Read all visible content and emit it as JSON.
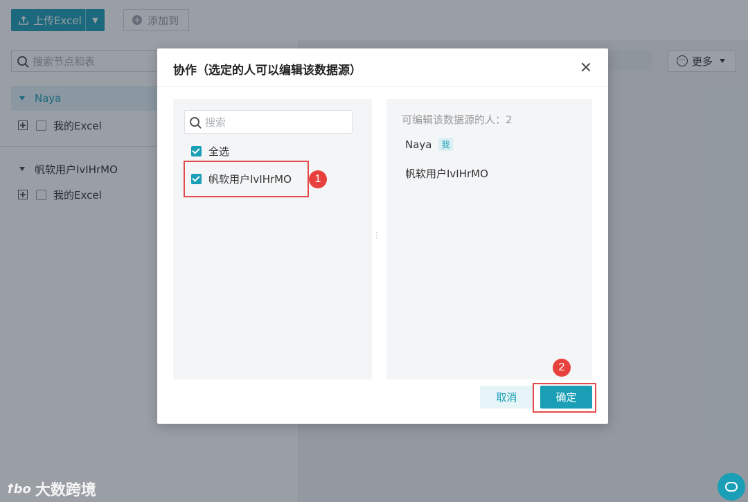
{
  "toolbar": {
    "upload_label": "上传Excel",
    "add_label": "添加到"
  },
  "left_panel": {
    "search_placeholder": "搜索节点和表",
    "groups": [
      {
        "name": "Naya",
        "item": "我的Excel"
      },
      {
        "name": "帆软用户IvIHrMO",
        "item": "我的Excel"
      }
    ]
  },
  "more_button": {
    "label": "更多"
  },
  "watermark": {
    "logo": "ꝉbo",
    "text": "大数跨境"
  },
  "dialog": {
    "title": "协作（选定的人可以编辑该数据源）",
    "search_placeholder": "搜索",
    "select_all_label": "全选",
    "users": [
      {
        "name": "帆软用户IvIHrMO",
        "checked": true
      }
    ],
    "editors_label": "可编辑该数据源的人：2",
    "editors": [
      {
        "name": "Naya",
        "tag": "我"
      },
      {
        "name": "帆软用户IvIHrMO",
        "tag": ""
      }
    ],
    "cancel_label": "取消",
    "confirm_label": "确定"
  },
  "annotations": [
    {
      "number": "1"
    },
    {
      "number": "2"
    }
  ],
  "colors": {
    "accent": "#1a9fb6",
    "highlight": "#e34a4a",
    "badge": "#e8413d"
  }
}
